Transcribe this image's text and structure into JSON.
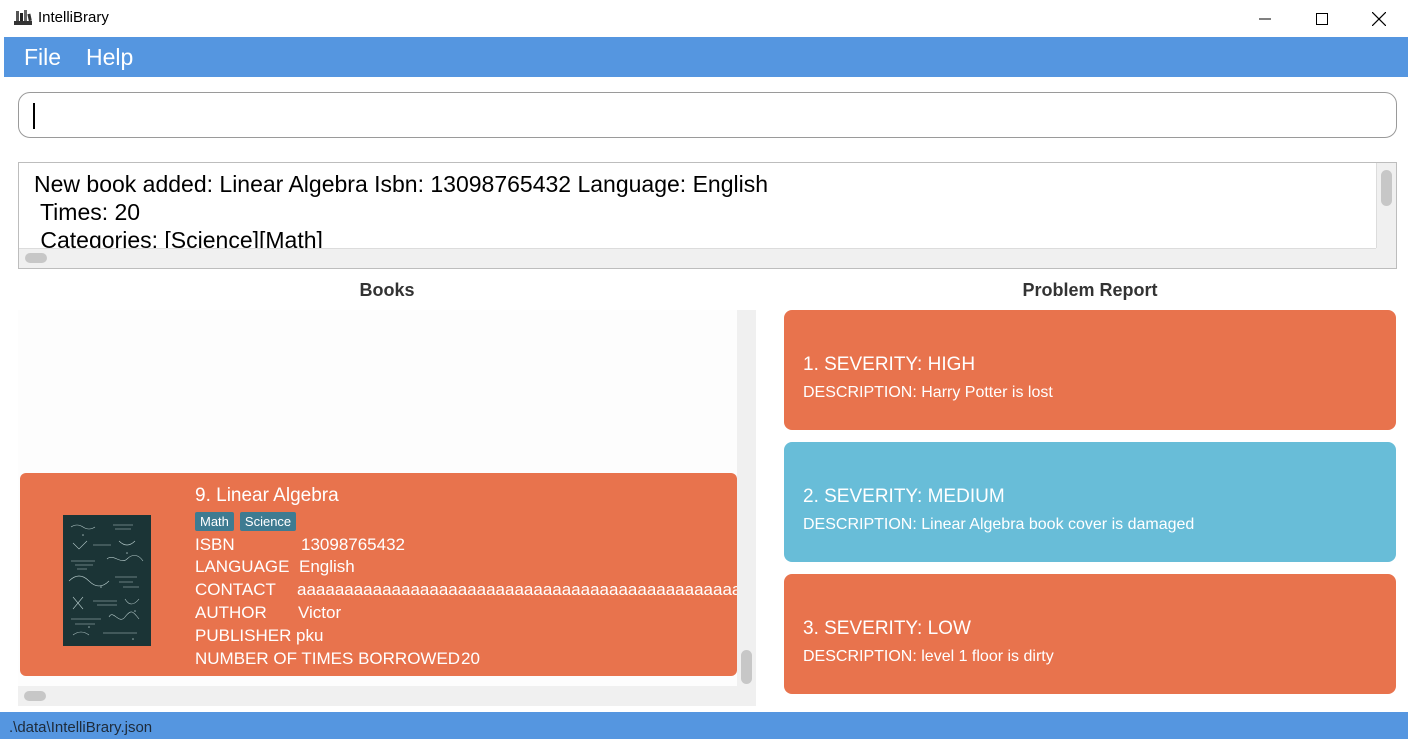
{
  "window": {
    "title": "IntelliBrary"
  },
  "menu": {
    "file": "File",
    "help": "Help"
  },
  "command": {
    "value": ""
  },
  "result": {
    "lines": [
      "New book added: Linear Algebra Isbn: 13098765432 Language: English",
      " Times: 20",
      " Categories: [Science][Math]"
    ]
  },
  "books": {
    "header": "Books",
    "cards": [
      {
        "index_title": "9.  Linear Algebra",
        "tags": [
          "Math",
          "Science"
        ],
        "isbn_label": "ISBN",
        "isbn": "13098765432",
        "language_label": "LANGUAGE",
        "language": "English",
        "contact_label": "CONTACT",
        "contact": "aaaaaaaaaaaaaaaaaaaaaaaaaaaaaaaaaaaaaaaaaaaaaaaaaaaaaaaaaaaaa",
        "author_label": "AUTHOR",
        "author": "Victor",
        "publisher_label": "PUBLISHER",
        "publisher": "pku",
        "times_label": "NUMBER OF TIMES BORROWED",
        "times": "20"
      }
    ]
  },
  "reports": {
    "header": "Problem Report",
    "items": [
      {
        "heading": "1.  SEVERITY: HIGH",
        "description": "DESCRIPTION: Harry Potter is lost",
        "color": "#e8734d"
      },
      {
        "heading": "2.  SEVERITY: MEDIUM",
        "description": "DESCRIPTION: Linear Algebra book cover is damaged",
        "color": "#68bdd8"
      },
      {
        "heading": "3.  SEVERITY: LOW",
        "description": "DESCRIPTION: level 1 floor is dirty",
        "color": "#e8734d"
      }
    ]
  },
  "status": {
    "path": ".\\data\\IntelliBrary.json"
  },
  "colors": {
    "accent": "#5596e0",
    "card_orange": "#e8734d",
    "card_blue": "#68bdd8",
    "tag": "#3e7b91"
  }
}
